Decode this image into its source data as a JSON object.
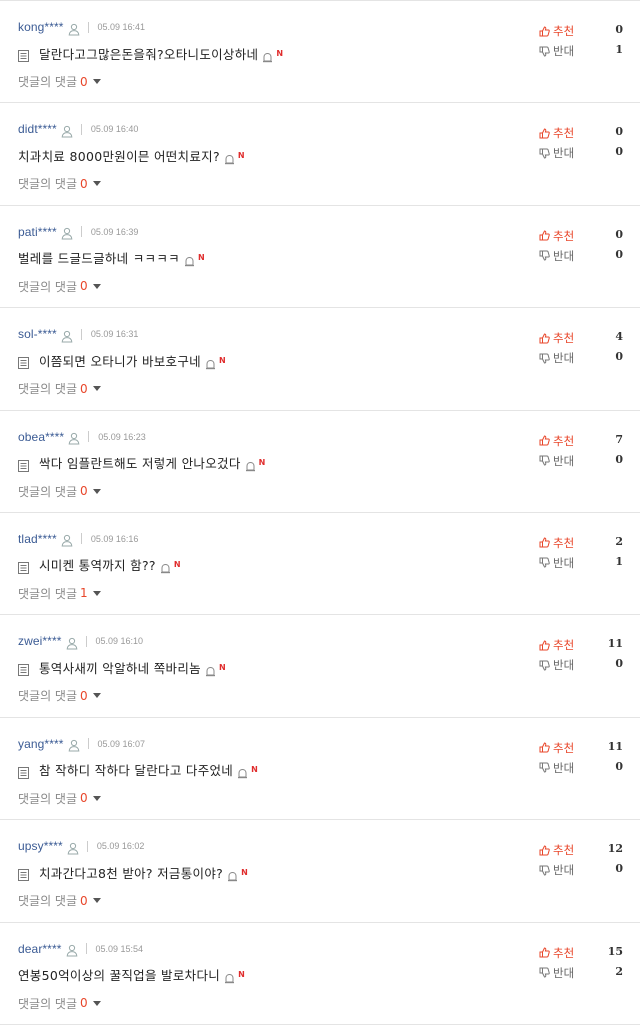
{
  "labels": {
    "recommend": "추천",
    "oppose": "반대",
    "replies_prefix": "댓글의 댓글",
    "new_badge": "N"
  },
  "colors": {
    "author": "#3b5b94",
    "recommend": "#e8462a",
    "reply_count": "#e8462a",
    "new_badge": "#e02d2d",
    "divider": "#e4e4e4"
  },
  "icons": {
    "user": "user-icon",
    "doc": "document-icon",
    "report": "report-icon",
    "thumbs_up": "thumbs-up-icon",
    "thumbs_down": "thumbs-down-icon",
    "caret": "caret-down-icon"
  },
  "comments": [
    {
      "author": "kong****",
      "time": "05.09 16:41",
      "text": "달란다고그많은돈을줘?오타니도이상하네",
      "doc_icon": true,
      "reply_count": "0",
      "up": "0",
      "down": "1"
    },
    {
      "author": "didt****",
      "time": "05.09 16:40",
      "text": "치과치료 8000만원이믄 어떤치료지?",
      "doc_icon": false,
      "reply_count": "0",
      "up": "0",
      "down": "0"
    },
    {
      "author": "pati****",
      "time": "05.09 16:39",
      "text": "벌레를 드글드글하네 ㅋㅋㅋㅋ",
      "doc_icon": false,
      "reply_count": "0",
      "up": "0",
      "down": "0"
    },
    {
      "author": "sol-****",
      "time": "05.09 16:31",
      "text": "이쯤되면 오타니가 바보호구네",
      "doc_icon": true,
      "reply_count": "0",
      "up": "4",
      "down": "0"
    },
    {
      "author": "obea****",
      "time": "05.09 16:23",
      "text": "싹다 임플란트해도 저렇게 안나오겄다",
      "doc_icon": true,
      "reply_count": "0",
      "up": "7",
      "down": "0"
    },
    {
      "author": "tlad****",
      "time": "05.09 16:16",
      "text": "시미켄 통역까지 함??",
      "doc_icon": true,
      "reply_count": "1",
      "up": "2",
      "down": "1"
    },
    {
      "author": "zwei****",
      "time": "05.09 16:10",
      "text": "통역사새끼 악알하네 쪽바리놈",
      "doc_icon": true,
      "reply_count": "0",
      "up": "11",
      "down": "0"
    },
    {
      "author": "yang****",
      "time": "05.09 16:07",
      "text": "참 작하디 작하다 달란다고 다주었네",
      "doc_icon": true,
      "reply_count": "0",
      "up": "11",
      "down": "0"
    },
    {
      "author": "upsy****",
      "time": "05.09 16:02",
      "text": "치과간다고8천 받아? 저금통이야?",
      "doc_icon": true,
      "reply_count": "0",
      "up": "12",
      "down": "0"
    },
    {
      "author": "dear****",
      "time": "05.09 15:54",
      "text": "연봉50억이상의 꿀직업을 발로차다니",
      "doc_icon": false,
      "reply_count": "0",
      "up": "15",
      "down": "2"
    }
  ]
}
